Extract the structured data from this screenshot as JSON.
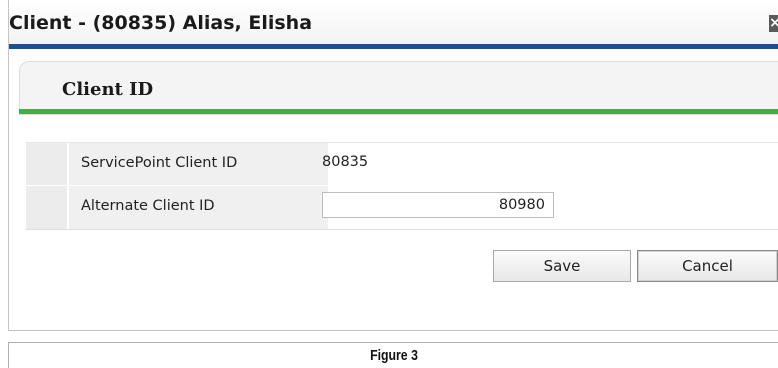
{
  "dialog": {
    "title": "Client - (80835) Alias, Elisha",
    "close_glyph": "×",
    "close_icon": "close-icon",
    "title_rule_color": "#1e4f8a"
  },
  "panel": {
    "title": "Client ID",
    "accent_color": "#33b54a"
  },
  "fields": [
    {
      "label": "ServicePoint Client ID",
      "value": "80835"
    },
    {
      "label": "Alternate Client ID",
      "value": "80980"
    }
  ],
  "buttons": {
    "save_label": "Save",
    "cancel_label": "Cancel"
  },
  "caption": "Figure 3"
}
